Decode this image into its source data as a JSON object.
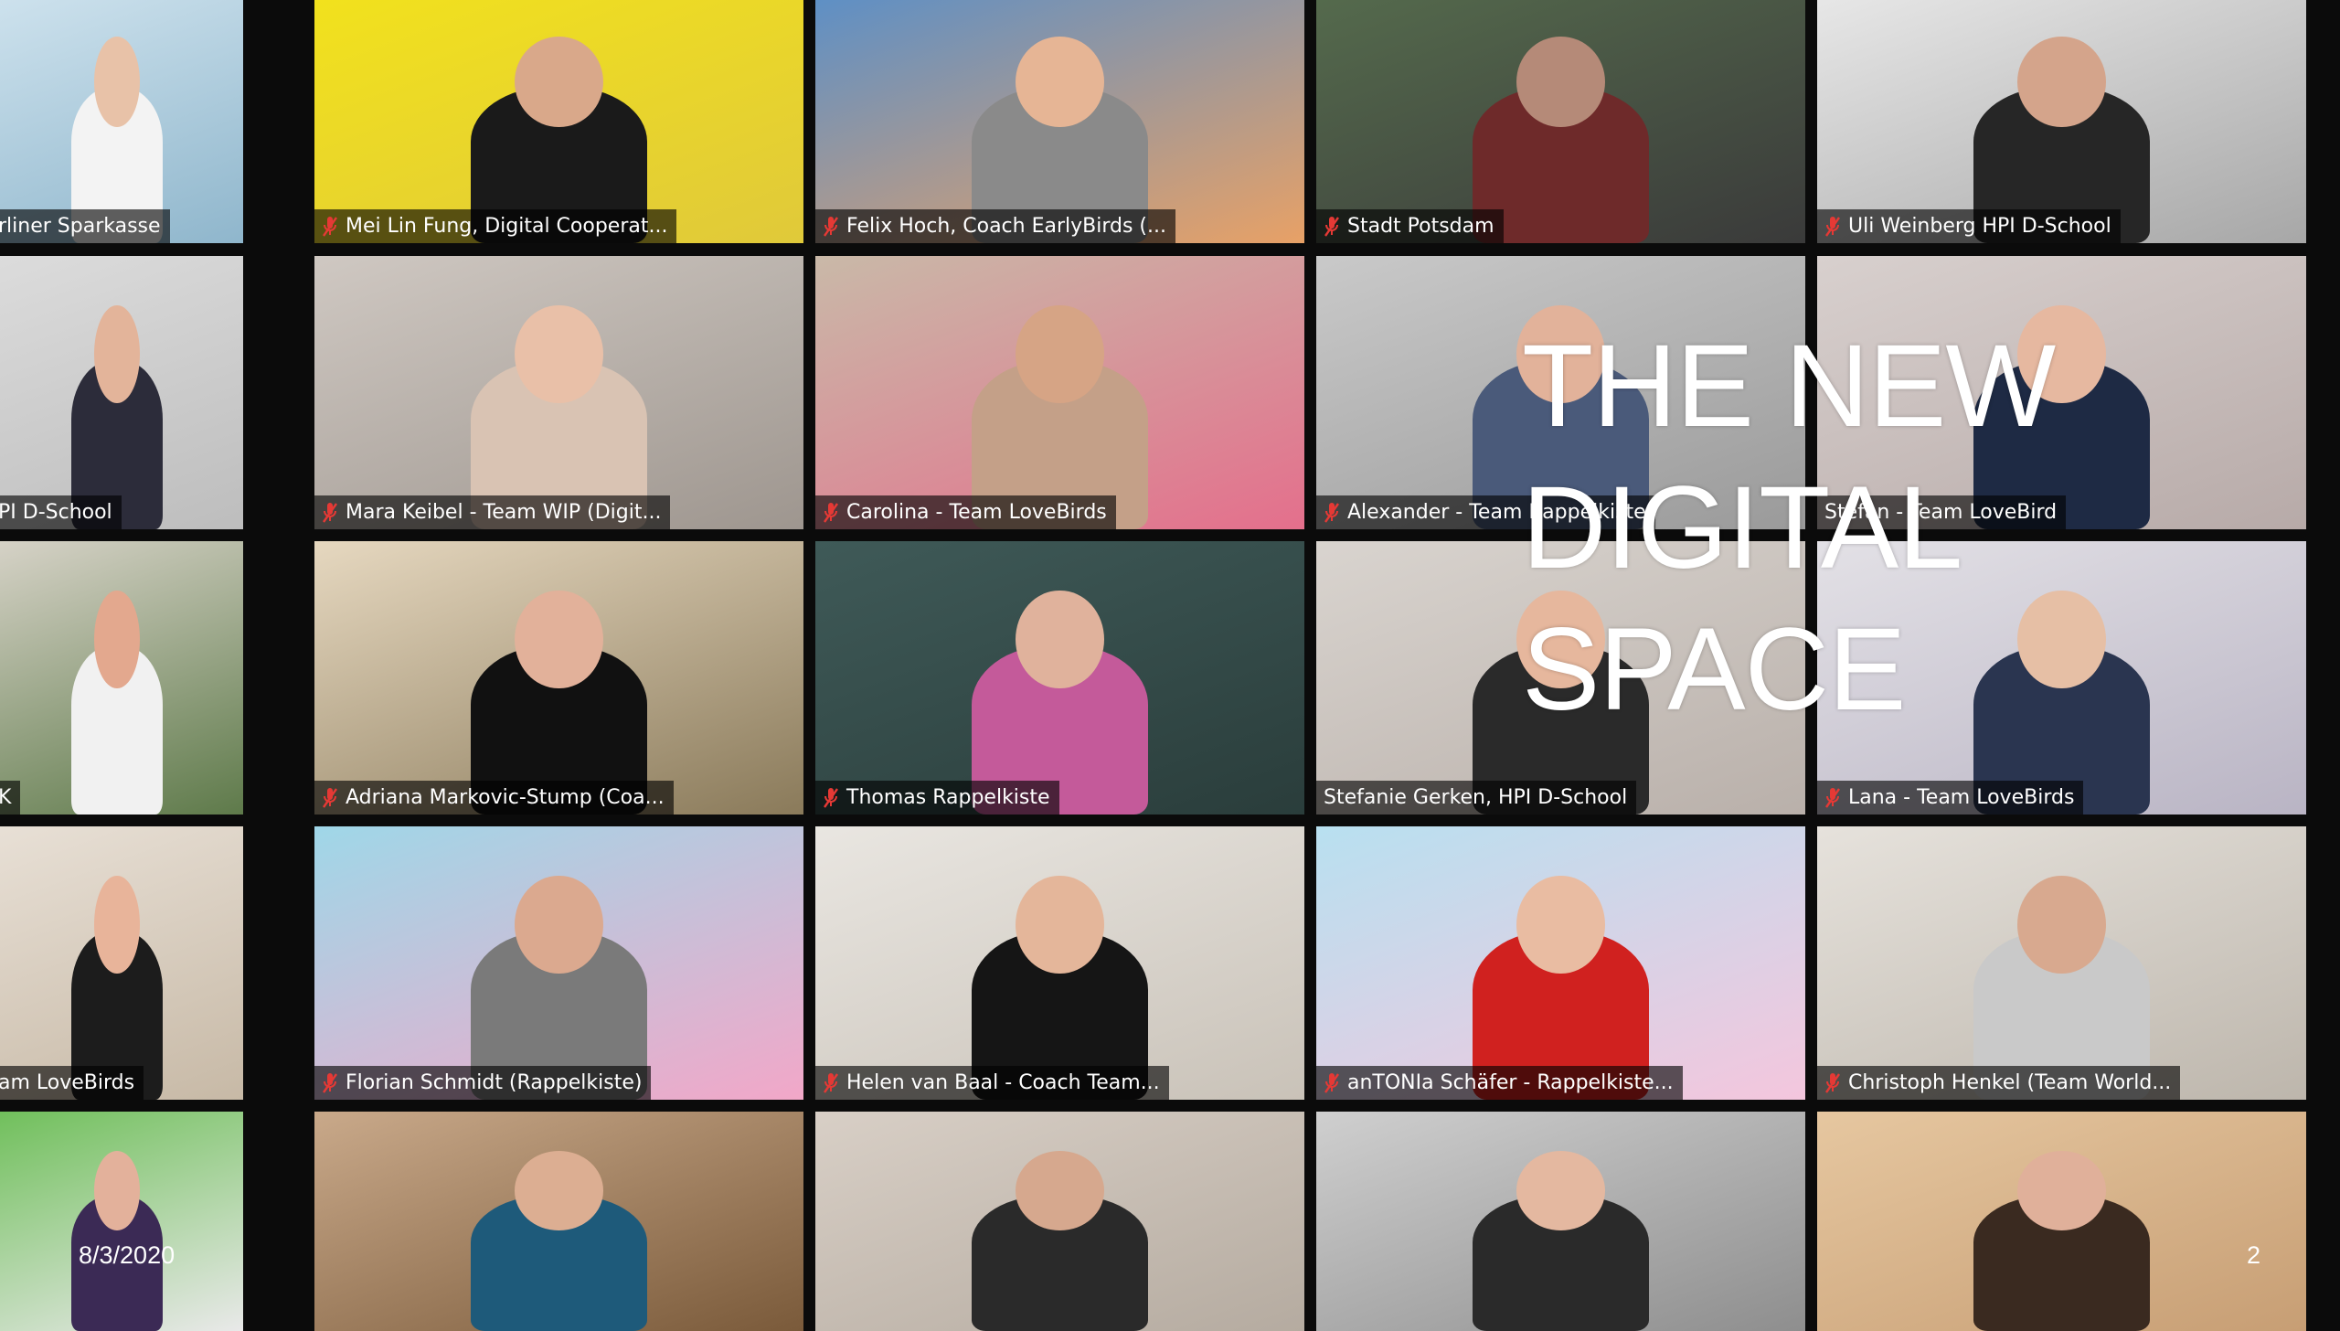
{
  "slide": {
    "title_lines": [
      "THE NEW",
      "DIGITAL",
      "SPACE"
    ],
    "date": "8/3/2020",
    "page_number": "2"
  },
  "colors": {
    "active_speaker_border": "#8bc34a",
    "label_background": "rgba(0,0,0,0.62)",
    "mute_icon": "#e53935"
  },
  "tiles": [
    {
      "name": "rliner Sparkasse",
      "muted": false,
      "bg": [
        "#cfe3ee",
        "#8fb6cc"
      ],
      "skin": "#e8c2a8",
      "shirt": "#f3f3f3"
    },
    {
      "name": "Mei Lin Fung, Digital Cooperat...",
      "muted": true,
      "bg": [
        "#f2e21c",
        "#e0c93a"
      ],
      "skin": "#d9a88a",
      "shirt": "#1a1a1a"
    },
    {
      "name": "Felix Hoch, Coach EarlyBirds (...",
      "muted": true,
      "bg": [
        "#5b8fc7",
        "#e8a166"
      ],
      "skin": "#e6b595",
      "shirt": "#8a8a8a"
    },
    {
      "name": "Stadt Potsdam",
      "muted": true,
      "bg": [
        "#556b4d",
        "#3a3a3a"
      ],
      "skin": "#b58a78",
      "shirt": "#6e2a2a"
    },
    {
      "name": "Uli Weinberg HPI D-School",
      "muted": true,
      "bg": [
        "#e8e8e8",
        "#a7a7a7"
      ],
      "skin": "#d4a48b",
      "shirt": "#262626"
    },
    {
      "name": "PI D-School",
      "muted": false,
      "bg": [
        "#dcdcdc",
        "#bdbdbd"
      ],
      "skin": "#e3b49a",
      "shirt": "#2c2c3a"
    },
    {
      "name": "Mara Keibel - Team WIP (Digit...",
      "muted": true,
      "bg": [
        "#cfc8c2",
        "#9e968f"
      ],
      "skin": "#e9c0a8",
      "shirt": "#d9c3b3"
    },
    {
      "name": "Carolina - Team LoveBirds",
      "muted": true,
      "bg": [
        "#c9b9a8",
        "#e46f8c"
      ],
      "skin": "#d6a485",
      "shirt": "#c4a088"
    },
    {
      "name": "Alexander - Team Rappelkiste",
      "muted": true,
      "bg": [
        "#c9c9c9",
        "#9a9a9a"
      ],
      "skin": "#e2b29a",
      "shirt": "#4a5a7a"
    },
    {
      "name": "Stefan - Team LoveBird",
      "muted": false,
      "bg": [
        "#d8d0ce",
        "#b7aaa8"
      ],
      "skin": "#e6b8a0",
      "shirt": "#1e2a44"
    },
    {
      "name": "K",
      "muted": false,
      "bg": [
        "#d7d3c8",
        "#5e7a4a"
      ],
      "skin": "#e3a88e",
      "shirt": "#f1f1f1"
    },
    {
      "name": "Adriana Markovic-Stump (Coa...",
      "muted": true,
      "bg": [
        "#e6d8c0",
        "#8a7a5a"
      ],
      "skin": "#e2b19a",
      "shirt": "#111111"
    },
    {
      "name": "Thomas Rappelkiste",
      "muted": true,
      "bg": [
        "#3f5a58",
        "#2a3d3b"
      ],
      "skin": "#e0b29c",
      "shirt": "#c45a9a"
    },
    {
      "name": "Stefanie Gerken, HPI D-School",
      "muted": false,
      "active": true,
      "bg": [
        "#d9d4cf",
        "#b9b0aa"
      ],
      "skin": "#e6b79d",
      "shirt": "#2a2a2a"
    },
    {
      "name": "Lana - Team LoveBirds",
      "muted": true,
      "bg": [
        "#e3e1e6",
        "#b9b4c4"
      ],
      "skin": "#e6bfa5",
      "shirt": "#2a3550"
    },
    {
      "name": "am LoveBirds",
      "muted": false,
      "bg": [
        "#e8e0d6",
        "#c7b9a6"
      ],
      "skin": "#e8b49a",
      "shirt": "#1c1c1c"
    },
    {
      "name": "Florian Schmidt (Rappelkiste)",
      "muted": true,
      "bg": [
        "#9fd7e8",
        "#f2a7c8"
      ],
      "skin": "#dba98f",
      "shirt": "#7a7a7a"
    },
    {
      "name": "Helen van Baal - Coach Team...",
      "muted": true,
      "bg": [
        "#e9e6e1",
        "#c9c2b8"
      ],
      "skin": "#e4b69a",
      "shirt": "#151515"
    },
    {
      "name": "anTONIa Schäfer - Rappelkiste...",
      "muted": true,
      "bg": [
        "#b8e0f0",
        "#f4c6dd"
      ],
      "skin": "#e9bca2",
      "shirt": "#d0211f"
    },
    {
      "name": "Christoph Henkel (Team World...",
      "muted": true,
      "bg": [
        "#e6e2dc",
        "#bdb6ac"
      ],
      "skin": "#d8a98f",
      "shirt": "#c9c9c9"
    },
    {
      "name": "",
      "muted": false,
      "bg": [
        "#6fbf5a",
        "#e9e9e9"
      ],
      "skin": "#e3b19b",
      "shirt": "#3b2a55"
    },
    {
      "name": "",
      "muted": false,
      "bg": [
        "#c9a98a",
        "#7a5a3a"
      ],
      "skin": "#dcae92",
      "shirt": "#1e5a7a"
    },
    {
      "name": "",
      "muted": false,
      "bg": [
        "#d8cfc6",
        "#b5aba0"
      ],
      "skin": "#d6a88e",
      "shirt": "#2a2a2a"
    },
    {
      "name": "",
      "muted": false,
      "bg": [
        "#cfcfcf",
        "#8e8e8e"
      ],
      "skin": "#e4b8a0",
      "shirt": "#2a2a2a"
    },
    {
      "name": "",
      "muted": false,
      "bg": [
        "#e6c7a0",
        "#c79e74"
      ],
      "skin": "#e0b09a",
      "shirt": "#3a2a20"
    }
  ]
}
